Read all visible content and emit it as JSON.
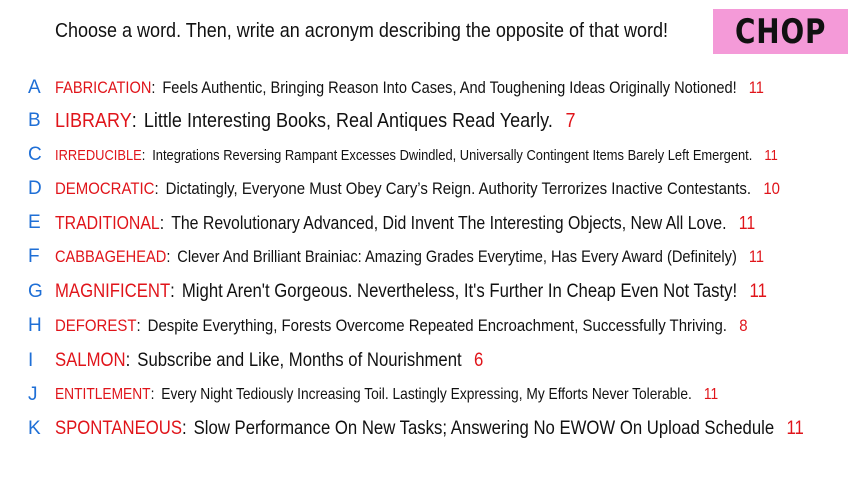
{
  "prompt": "Choose a word. Then, write an acronym describing the opposite of that word!",
  "badge": "CHOP",
  "colors": {
    "letter": "#1f6fd6",
    "word": "#e0141a",
    "count": "#e0141a",
    "badge_bg": "#f49ad8"
  },
  "rows": [
    {
      "letter": "A",
      "word": "FABRICATION",
      "phrase": "Feels Authentic, Bringing Reason Into Cases, And Toughening Ideas Originally Notioned!",
      "count": "11"
    },
    {
      "letter": "B",
      "word": "LIBRARY",
      "phrase": "Little Interesting Books, Real Antiques Read Yearly.",
      "count": "7"
    },
    {
      "letter": "C",
      "word": "IRREDUCIBLE",
      "phrase": "Integrations Reversing Rampant Excesses Dwindled, Universally Contingent Items Barely Left Emergent.",
      "count": "11"
    },
    {
      "letter": "D",
      "word": "DEMOCRATIC",
      "phrase": "Dictatingly, Everyone Must Obey Cary’s Reign. Authority Terrorizes Inactive Contestants.",
      "count": "10"
    },
    {
      "letter": "E",
      "word": "TRADITIONAL",
      "phrase": "The Revolutionary Advanced, Did Invent The Interesting Objects, New All Love.",
      "count": "11"
    },
    {
      "letter": "F",
      "word": "CABBAGEHEAD",
      "phrase": "Clever And Brilliant Brainiac: Amazing Grades Everytime, Has Every Award (Definitely)",
      "count": "11"
    },
    {
      "letter": "G",
      "word": "MAGNIFICENT",
      "phrase": "Might Aren't Gorgeous. Nevertheless, It's Further In Cheap Even Not Tasty!",
      "count": "11"
    },
    {
      "letter": "H",
      "word": "DEFOREST",
      "phrase": "Despite Everything, Forests Overcome Repeated Encroachment, Successfully Thriving.",
      "count": "8"
    },
    {
      "letter": "I",
      "word": "SALMON",
      "phrase": "Subscribe and Like, Months of Nourishment",
      "count": "6"
    },
    {
      "letter": "J",
      "word": "ENTITLEMENT",
      "phrase": "Every Night Tediously Increasing Toil. Lastingly Expressing, My Efforts Never Tolerable.",
      "count": "11"
    },
    {
      "letter": "K",
      "word": "SPONTANEOUS",
      "phrase": "Slow Performance On New Tasks; Answering No EWOW On Upload Schedule",
      "count": "11"
    }
  ]
}
